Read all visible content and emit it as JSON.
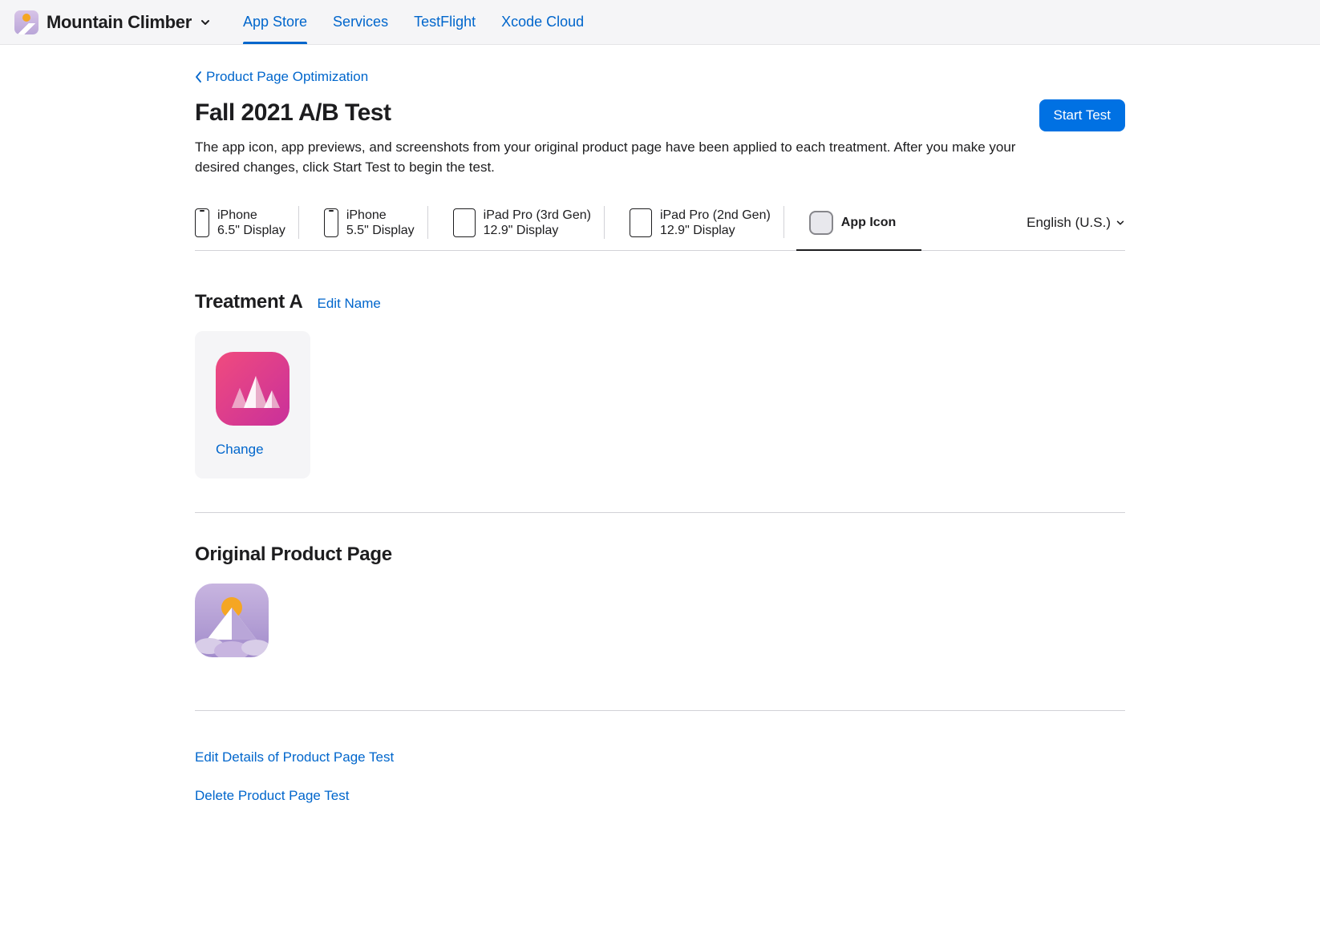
{
  "header": {
    "app_name": "Mountain Climber",
    "tabs": [
      {
        "label": "App Store",
        "active": true
      },
      {
        "label": "Services",
        "active": false
      },
      {
        "label": "TestFlight",
        "active": false
      },
      {
        "label": "Xcode Cloud",
        "active": false
      }
    ]
  },
  "back_link": "Product Page Optimization",
  "page_title": "Fall 2021 A/B Test",
  "start_test_label": "Start Test",
  "description": "The app icon, app previews, and screenshots from your original product page have been applied to each treatment. After you make your desired changes, click Start Test to begin the test.",
  "device_tabs": [
    {
      "line1": "iPhone",
      "line2": "6.5\" Display",
      "type": "phone"
    },
    {
      "line1": "iPhone",
      "line2": "5.5\" Display",
      "type": "phone"
    },
    {
      "line1": "iPad Pro (3rd Gen)",
      "line2": "12.9\" Display",
      "type": "ipad"
    },
    {
      "line1": "iPad Pro (2nd Gen)",
      "line2": "12.9\" Display",
      "type": "ipad"
    },
    {
      "line1": "App Icon",
      "line2": "",
      "type": "appicon",
      "active": true
    }
  ],
  "language": "English (U.S.)",
  "treatment": {
    "title": "Treatment A",
    "edit_name_label": "Edit Name",
    "change_label": "Change"
  },
  "original": {
    "title": "Original Product Page"
  },
  "footer": {
    "edit_details": "Edit Details of Product Page Test",
    "delete_test": "Delete Product Page Test"
  }
}
